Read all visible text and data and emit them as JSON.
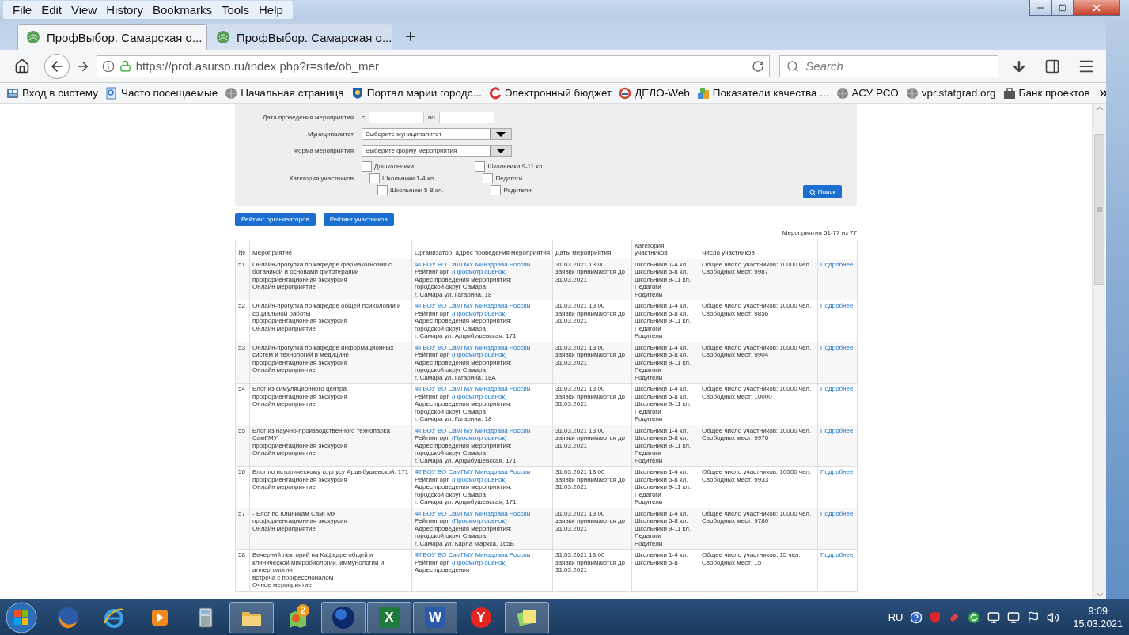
{
  "menu": [
    "File",
    "Edit",
    "View",
    "History",
    "Bookmarks",
    "Tools",
    "Help"
  ],
  "tabs": [
    {
      "title": "ПрофВыбор. Самарская о...",
      "selected": true
    },
    {
      "title": "ПрофВыбор. Самарская о...",
      "selected": false
    }
  ],
  "address_bar": {
    "url": "https://prof.asurso.ru/index.php?r=site/ob_mer"
  },
  "search": {
    "placeholder": "Search"
  },
  "bookmarks": [
    {
      "label": "Вход в систему",
      "kind": "app"
    },
    {
      "label": "Часто посещаемые",
      "kind": "search"
    },
    {
      "label": "Начальная страница",
      "kind": "globe"
    },
    {
      "label": "Портал мэрии городс...",
      "kind": "crest"
    },
    {
      "label": "Электронный бюджет",
      "kind": "swirl"
    },
    {
      "label": "ДЕЛО-Web",
      "kind": "ring"
    },
    {
      "label": "Показатели качества ...",
      "kind": "blocks"
    },
    {
      "label": "АСУ РСО",
      "kind": "globe"
    },
    {
      "label": "vpr.statgrad.org",
      "kind": "globe"
    },
    {
      "label": "Банк проектов",
      "kind": "bank"
    }
  ],
  "filter": {
    "date_label": "Дата проведения мероприятия",
    "from_label": "с",
    "to_label": "по",
    "municipality_label": "Муниципалитет",
    "municipality_value": "Выберите муниципалитет",
    "form_label": "Форма мероприятия",
    "form_value": "Выберите форму мероприятия",
    "category_label": "Категория участников",
    "categories": [
      {
        "label": "Дошкольники",
        "checked": false
      },
      {
        "label": "Школьники 1-4 кл.",
        "checked": false
      },
      {
        "label": "Школьники 5-8 кл.",
        "checked": false
      },
      {
        "label": "Школьники 9-11 кл.",
        "checked": false
      },
      {
        "label": "Педагоги",
        "checked": false
      },
      {
        "label": "Родители",
        "checked": false
      }
    ],
    "search_button": "Поиск"
  },
  "rating_buttons": [
    "Рейтинг организаторов",
    "Рейтинг участников"
  ],
  "pager": "Мероприятия 51-77 из 77",
  "table": {
    "columns": [
      "№",
      "Мероприятие",
      "Организатор, адрес проведения мероприятия",
      "Даты мероприятия",
      "Категория участников",
      "Число участников"
    ],
    "rows": [
      {
        "no": "51",
        "event": [
          "Онлайн-прогулка по кафедре фармакогнозии с ботаникой и основами фитотерапии",
          "профориентационная экскурсия",
          "Онлайн мероприятие"
        ],
        "organizer": {
          "name": "ФГБОУ ВО СамГМУ Минздрава России",
          "rating_label": "Рейтинг орг.",
          "rating_link": "(Просмотр оценок)",
          "address_label": "Адрес проведения мероприятия:",
          "district": "городской округ Самара",
          "address": "г. Самара ул. Гагарина, 18"
        },
        "dates": [
          "31.03.2021 13:00",
          "заявки принимаются до 31.03.2021"
        ],
        "categories": [
          "Школьники 1-4 кл.",
          "Школьники 5-8 кл.",
          "Школьники 9-11 кл.",
          "Педагоги",
          "Родители"
        ],
        "participants": [
          "Общее число участников: 10000 чел.",
          "Свободных мест: 9987"
        ],
        "details": "Подробнее"
      },
      {
        "no": "52",
        "event": [
          "Онлайн-прогулка по кафедре общей психологии и социальной работы",
          "профориентационная экскурсия",
          "Онлайн мероприятие"
        ],
        "organizer": {
          "name": "ФГБОУ ВО СамГМУ Минздрава России",
          "rating_label": "Рейтинг орг.",
          "rating_link": "(Просмотр оценок)",
          "address_label": "Адрес проведения мероприятия:",
          "district": "городской округ Самара",
          "address": "г. Самара ул. Арцыбушевская, 171"
        },
        "dates": [
          "31.03.2021 13:00",
          "заявки принимаются до 31.03.2021"
        ],
        "categories": [
          "Школьники 1-4 кл.",
          "Школьники 5-8 кл.",
          "Школьники 9-11 кл.",
          "Педагоги",
          "Родители"
        ],
        "participants": [
          "Общее число участников: 10000 чел.",
          "Свободных мест: 9856"
        ],
        "details": "Подробнее"
      },
      {
        "no": "53",
        "event": [
          "Онлайн-прогулка по кафедре информационных систем и технологий в медицине",
          "профориентационная экскурсия",
          "Онлайн мероприятие"
        ],
        "organizer": {
          "name": "ФГБОУ ВО СамГМУ Минздрава России",
          "rating_label": "Рейтинг орг.",
          "rating_link": "(Просмотр оценок)",
          "address_label": "Адрес проведения мероприятия:",
          "district": "городской округ Самара",
          "address": "г. Самара ул. Гагарина, 18А"
        },
        "dates": [
          "31.03.2021 13:00",
          "заявки принимаются до 31.03.2021"
        ],
        "categories": [
          "Школьники 1-4 кл.",
          "Школьники 5-8 кл.",
          "Школьники 9-11 кл.",
          "Педагоги",
          "Родители"
        ],
        "participants": [
          "Общее число участников: 10000 чел.",
          "Свободных мест: 9904"
        ],
        "details": "Подробнее"
      },
      {
        "no": "54",
        "event": [
          "Блог из симуляционного центра",
          "профориентационная экскурсия",
          "Онлайн мероприятие"
        ],
        "organizer": {
          "name": "ФГБОУ ВО СамГМУ Минздрава России",
          "rating_label": "Рейтинг орг.",
          "rating_link": "(Просмотр оценок)",
          "address_label": "Адрес проведения мероприятия:",
          "district": "городской округ Самара",
          "address": "г. Самара ул. Гагарина, 18"
        },
        "dates": [
          "31.03.2021 13:00",
          "заявки принимаются до 31.03.2021"
        ],
        "categories": [
          "Школьники 1-4 кл.",
          "Школьники 5-8 кл.",
          "Школьники 9-11 кл.",
          "Педагоги",
          "Родители"
        ],
        "participants": [
          "Общее число участников: 10000 чел.",
          "Свободных мест: 10000"
        ],
        "details": "Подробнее"
      },
      {
        "no": "55",
        "event": [
          "Блог из научно-производственного технопарка СамГМУ",
          "профориентационная экскурсия",
          "Онлайн мероприятие"
        ],
        "organizer": {
          "name": "ФГБОУ ВО СамГМУ Минздрава России",
          "rating_label": "Рейтинг орг.",
          "rating_link": "(Просмотр оценок)",
          "address_label": "Адрес проведения мероприятия:",
          "district": "городской округ Самара",
          "address": "г. Самара ул. Арцыбушевская, 171"
        },
        "dates": [
          "31.03.2021 13:00",
          "заявки принимаются до 31.03.2021"
        ],
        "categories": [
          "Школьники 1-4 кл.",
          "Школьники 5-8 кл.",
          "Школьники 9-11 кл.",
          "Педагоги",
          "Родители"
        ],
        "participants": [
          "Общее число участников: 10000 чел.",
          "Свободных мест: 9976"
        ],
        "details": "Подробнее"
      },
      {
        "no": "56",
        "event": [
          "Блог по историческому корпусу Арцыбушевской, 171",
          "профориентационная экскурсия",
          "Онлайн мероприятие"
        ],
        "organizer": {
          "name": "ФГБОУ ВО СамГМУ Минздрава России",
          "rating_label": "Рейтинг орг.",
          "rating_link": "(Просмотр оценок)",
          "address_label": "Адрес проведения мероприятия:",
          "district": "городской округ Самара",
          "address": "г. Самара ул. Арцыбушевская, 171"
        },
        "dates": [
          "31.03.2021 13:00",
          "заявки принимаются до 31.03.2021"
        ],
        "categories": [
          "Школьники 1-4 кл.",
          "Школьники 5-8 кл.",
          "Школьники 9-11 кл.",
          "Педагоги",
          "Родители"
        ],
        "participants": [
          "Общее число участников: 10000 чел.",
          "Свободных мест: 9933"
        ],
        "details": "Подробнее"
      },
      {
        "no": "57",
        "event": [
          "- Блог по Клиникам СамГМУ",
          "профориентационная экскурсия",
          "Онлайн мероприятие"
        ],
        "organizer": {
          "name": "ФГБОУ ВО СамГМУ Минздрава России",
          "rating_label": "Рейтинг орг.",
          "rating_link": "(Просмотр оценок)",
          "address_label": "Адрес проведения мероприятия:",
          "district": "городской округ Самара",
          "address": "г. Самара ул. Карла Маркса, 165Б"
        },
        "dates": [
          "31.03.2021 13:00",
          "заявки принимаются до 31.03.2021"
        ],
        "categories": [
          "Школьники 1-4 кл.",
          "Школьники 5-8 кл.",
          "Школьники 9-11 кл.",
          "Педагоги",
          "Родители"
        ],
        "participants": [
          "Общее число участников: 10000 чел.",
          "Свободных мест: 9780"
        ],
        "details": "Подробнее"
      },
      {
        "no": "58",
        "event": [
          "Вечерний лекторий на Кафедре общей и клинической микробиологии, иммунологии и аллергологии",
          "встреча с профессионалом",
          "Очное мероприятие"
        ],
        "organizer": {
          "name": "ФГБОУ ВО СамГМУ Минздрава России",
          "rating_label": "Рейтинг орг.",
          "rating_link": "(Просмотр оценок)",
          "address_label": "Адрес проведения"
        },
        "dates": [
          "31.03.2021 13:00",
          "заявки принимаются до 31.03.2021"
        ],
        "categories": [
          "Школьники 1-4 кл.",
          "Школьники 5-8"
        ],
        "participants": [
          "Общее число участников: 15 чел.",
          "Свободных мест: 15"
        ],
        "details": "Подробнее"
      }
    ]
  },
  "taskbar": {
    "items": [
      {
        "kind": "firefox",
        "running": false
      },
      {
        "kind": "ie",
        "running": false
      },
      {
        "kind": "media",
        "running": false
      },
      {
        "kind": "calculator",
        "running": false
      },
      {
        "kind": "folder",
        "running": true
      },
      {
        "kind": "maps",
        "running": false,
        "badge": "2"
      },
      {
        "kind": "globe",
        "running": true
      },
      {
        "kind": "excel",
        "running": true,
        "glyph": "X"
      },
      {
        "kind": "word",
        "running": true,
        "glyph": "W"
      },
      {
        "kind": "yandex",
        "running": false,
        "glyph": "Y"
      },
      {
        "kind": "notes",
        "running": true
      }
    ],
    "language": "RU",
    "time": "9:09",
    "date": "15.03.2021"
  }
}
